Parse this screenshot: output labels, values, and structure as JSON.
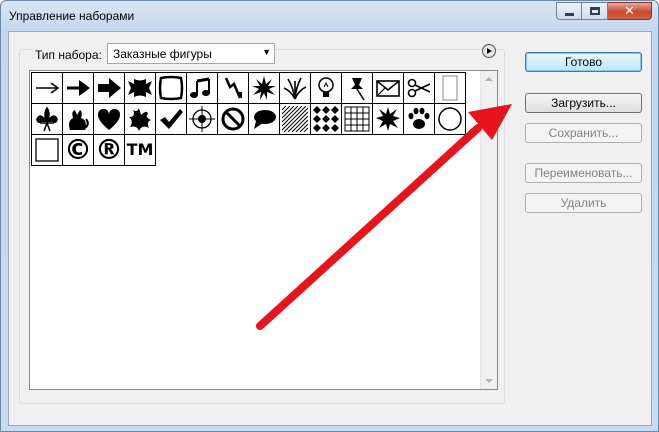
{
  "window": {
    "title": "Управление наборами"
  },
  "set_type": {
    "label": "Тип набора:",
    "selected": "Заказные фигуры"
  },
  "shapes": [
    {
      "icon": "thin-arrow-icon"
    },
    {
      "icon": "arrow-icon"
    },
    {
      "icon": "bold-arrow-icon"
    },
    {
      "icon": "banner-icon"
    },
    {
      "icon": "frame-icon"
    },
    {
      "icon": "music-notes-icon"
    },
    {
      "icon": "lightning-icon"
    },
    {
      "icon": "starburst-icon"
    },
    {
      "icon": "grass-icon"
    },
    {
      "icon": "light-bulb-icon"
    },
    {
      "icon": "pushpin-icon"
    },
    {
      "icon": "envelope-icon"
    },
    {
      "icon": "scissors-icon"
    },
    {
      "icon": "blank-page-icon"
    },
    {
      "icon": "fleur-de-lis-icon"
    },
    {
      "icon": "cat-icon"
    },
    {
      "icon": "heart-icon"
    },
    {
      "icon": "splat-icon"
    },
    {
      "icon": "check-mark-icon"
    },
    {
      "icon": "target-icon"
    },
    {
      "icon": "no-sign-icon"
    },
    {
      "icon": "speech-bubble-icon"
    },
    {
      "icon": "hatch-pattern-icon"
    },
    {
      "icon": "diamond-grid-icon"
    },
    {
      "icon": "square-grid-icon"
    },
    {
      "icon": "burst-icon"
    },
    {
      "icon": "paw-print-icon"
    },
    {
      "icon": "circle-icon"
    },
    {
      "icon": "square-icon"
    },
    {
      "icon": "copyright-icon",
      "glyph": "©"
    },
    {
      "icon": "registered-icon",
      "glyph": "®"
    },
    {
      "icon": "trademark-icon",
      "glyph": "TM"
    }
  ],
  "buttons": {
    "done": "Готово",
    "load": "Загрузить...",
    "save": "Сохранить...",
    "rename": "Переименовать...",
    "delete": "Удалить"
  },
  "colors": {
    "annotation_arrow": "#e8141b"
  }
}
